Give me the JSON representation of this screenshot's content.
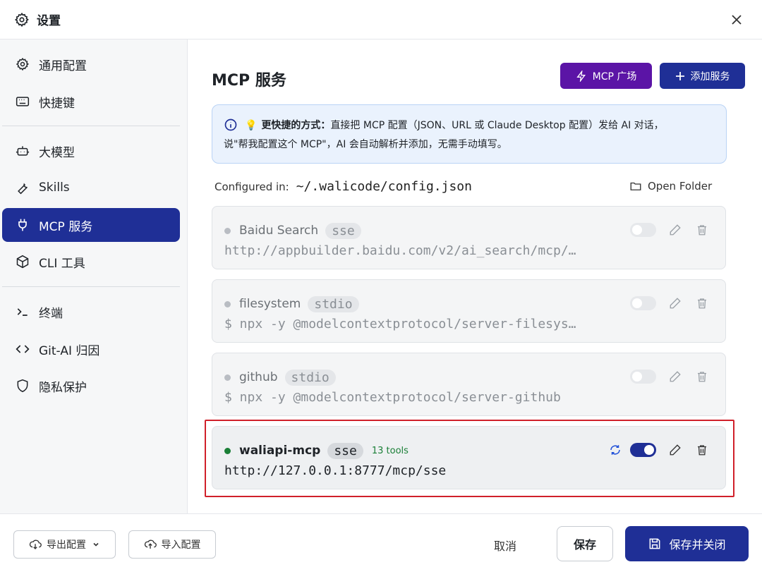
{
  "window": {
    "title": "设置",
    "title_icon": "gear-icon",
    "close_icon": "close-icon"
  },
  "sidebar": {
    "items": [
      {
        "label": "通用配置",
        "icon": "gear-icon",
        "active": false
      },
      {
        "label": "快捷键",
        "icon": "keyboard-icon",
        "active": false
      },
      {
        "label": "大模型",
        "icon": "robot-icon",
        "active": false
      },
      {
        "label": "Skills",
        "icon": "wrench-icon",
        "active": false
      },
      {
        "label": "MCP 服务",
        "icon": "plug-icon",
        "active": true
      },
      {
        "label": "CLI 工具",
        "icon": "cube-icon",
        "active": false
      },
      {
        "label": "终端",
        "icon": "terminal-icon",
        "active": false
      },
      {
        "label": "Git-AI 归因",
        "icon": "code-icon",
        "active": false
      },
      {
        "label": "隐私保护",
        "icon": "shield-icon",
        "active": false
      }
    ]
  },
  "main": {
    "title": "MCP 服务",
    "plaza_button": "MCP 广场",
    "add_button": "添加服务",
    "tip": {
      "bold": "更快捷的方式：",
      "line1": "直接把 MCP 配置（JSON、URL 或 Claude Desktop 配置）发给 AI 对话，",
      "line2": "说\"帮我配置这个 MCP\"，AI 会自动解析并添加，无需手动填写。"
    },
    "configured_label": "Configured in:",
    "config_path": "~/.walicode/config.json",
    "open_folder": "Open Folder",
    "servers": [
      {
        "name": "Baidu Search",
        "type": "sse",
        "command": "http://appbuilder.baidu.com/v2/ai_search/mcp/…",
        "enabled": false,
        "tools": ""
      },
      {
        "name": "filesystem",
        "type": "stdio",
        "command": "$ npx -y @modelcontextprotocol/server-filesys…",
        "enabled": false,
        "tools": ""
      },
      {
        "name": "github",
        "type": "stdio",
        "command": "$ npx -y @modelcontextprotocol/server-github",
        "enabled": false,
        "tools": ""
      },
      {
        "name": "waliapi-mcp",
        "type": "sse",
        "command": "http://127.0.0.1:8777/mcp/sse",
        "enabled": true,
        "tools": "13 tools"
      }
    ]
  },
  "footer": {
    "export": "导出配置",
    "import": "导入配置",
    "cancel": "取消",
    "save": "保存",
    "save_close": "保存并关闭"
  },
  "colors": {
    "primary": "#1f2f96",
    "plaza": "#5b14a6",
    "success": "#1a7f37",
    "highlight": "#d0202a",
    "tip_bg": "#eaf2fd"
  }
}
